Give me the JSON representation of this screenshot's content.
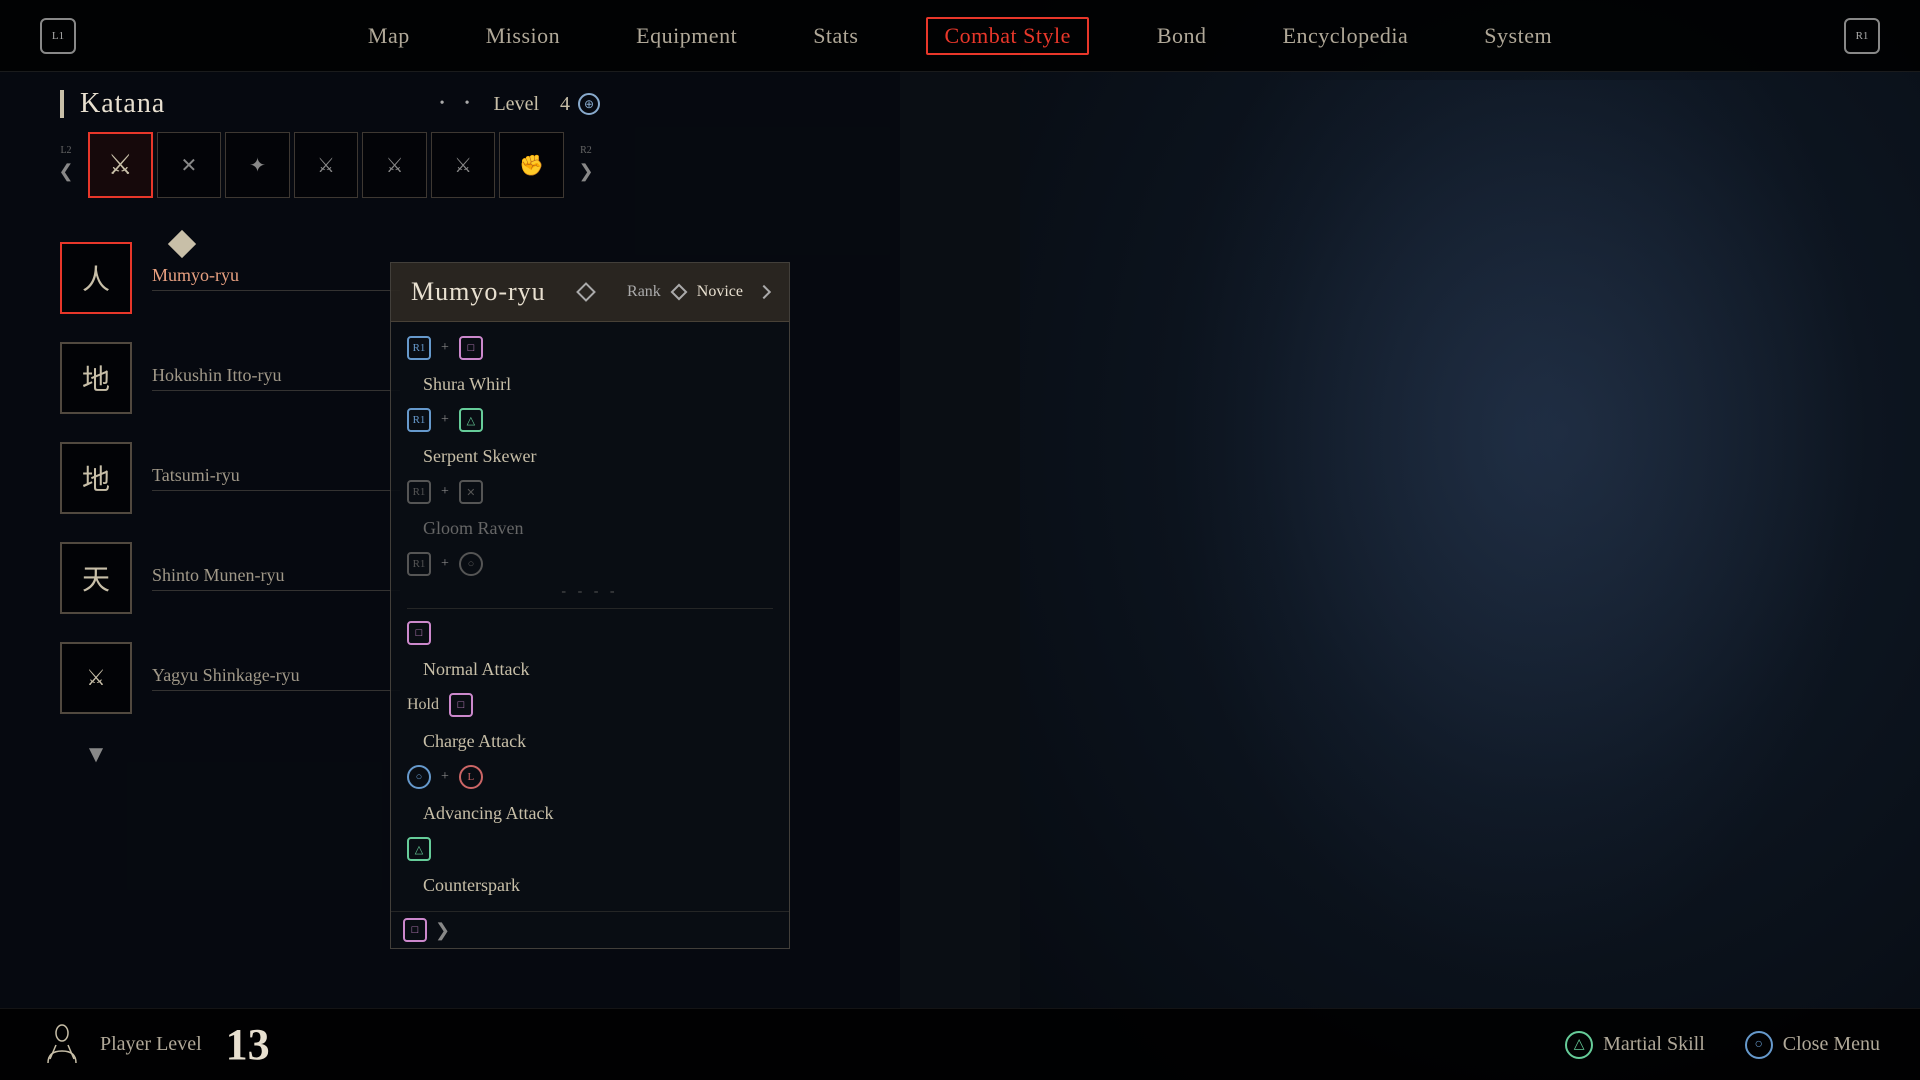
{
  "nav": {
    "l1_label": "L1",
    "r1_label": "R1",
    "items": [
      {
        "label": "Map",
        "active": false
      },
      {
        "label": "Mission",
        "active": false
      },
      {
        "label": "Equipment",
        "active": false
      },
      {
        "label": "Stats",
        "active": false
      },
      {
        "label": "Combat Style",
        "active": true
      },
      {
        "label": "Bond",
        "active": false
      },
      {
        "label": "Encyclopedia",
        "active": false
      },
      {
        "label": "System",
        "active": false
      }
    ]
  },
  "weapon": {
    "title": "Katana",
    "level_label": "Level",
    "level_value": "4",
    "left_arrow": "❮",
    "right_arrow": "❯",
    "l2_label": "L2",
    "r2_label": "R2",
    "slots": [
      {
        "selected": true,
        "icon": "⚔"
      },
      {
        "selected": false,
        "icon": "✕"
      },
      {
        "selected": false,
        "icon": "✦"
      },
      {
        "selected": false,
        "icon": "⚔"
      },
      {
        "selected": false,
        "icon": "⚔"
      },
      {
        "selected": false,
        "icon": "⚔"
      },
      {
        "selected": false,
        "icon": "✊"
      }
    ]
  },
  "styles": [
    {
      "name": "Mumyo-ryu",
      "icon": "人",
      "selected": true,
      "active": true
    },
    {
      "name": "Hokushin Itto-ryu",
      "icon": "地",
      "selected": false,
      "active": false
    },
    {
      "name": "Tatsumi-ryu",
      "icon": "地",
      "selected": false,
      "active": false
    },
    {
      "name": "Shinto Munen-ryu",
      "icon": "天",
      "selected": false,
      "active": false
    },
    {
      "name": "Yagyu Shinkage-ryu",
      "icon": "⚔",
      "selected": false,
      "active": false
    }
  ],
  "detail": {
    "title": "Mumyo-ryu",
    "rank_label": "Rank",
    "rank_value": "Novice",
    "skills": [
      {
        "type": "combo",
        "btn1": "R1",
        "btn2": "□",
        "name": "Shura Whirl",
        "disabled": false
      },
      {
        "type": "combo",
        "btn1": "R1",
        "btn2": "△",
        "name": "Serpent Skewer",
        "disabled": false
      },
      {
        "type": "combo",
        "btn1": "R1",
        "btn2": "✕",
        "name": "Gloom Raven",
        "disabled": true
      },
      {
        "type": "combo",
        "btn1": "R1",
        "btn2": "○",
        "name": "",
        "disabled": true
      },
      {
        "type": "divider"
      },
      {
        "type": "single",
        "btn1": "□",
        "name": "Normal Attack",
        "disabled": false
      },
      {
        "type": "hold",
        "hold_label": "Hold",
        "btn1": "□",
        "name": "Charge Attack",
        "disabled": false
      },
      {
        "type": "combo2",
        "btn1": "○",
        "btn2": "L",
        "name": "Advancing Attack",
        "disabled": false
      },
      {
        "type": "single-tri",
        "btn1": "△",
        "name": "Counterspark",
        "disabled": false
      }
    ]
  },
  "bottom": {
    "player_label": "Player Level",
    "player_level": "13",
    "actions": [
      {
        "badge_type": "triangle",
        "badge_label": "△",
        "label": "Martial Skill"
      },
      {
        "badge_type": "circle",
        "badge_label": "○",
        "label": "Close Menu"
      }
    ]
  }
}
